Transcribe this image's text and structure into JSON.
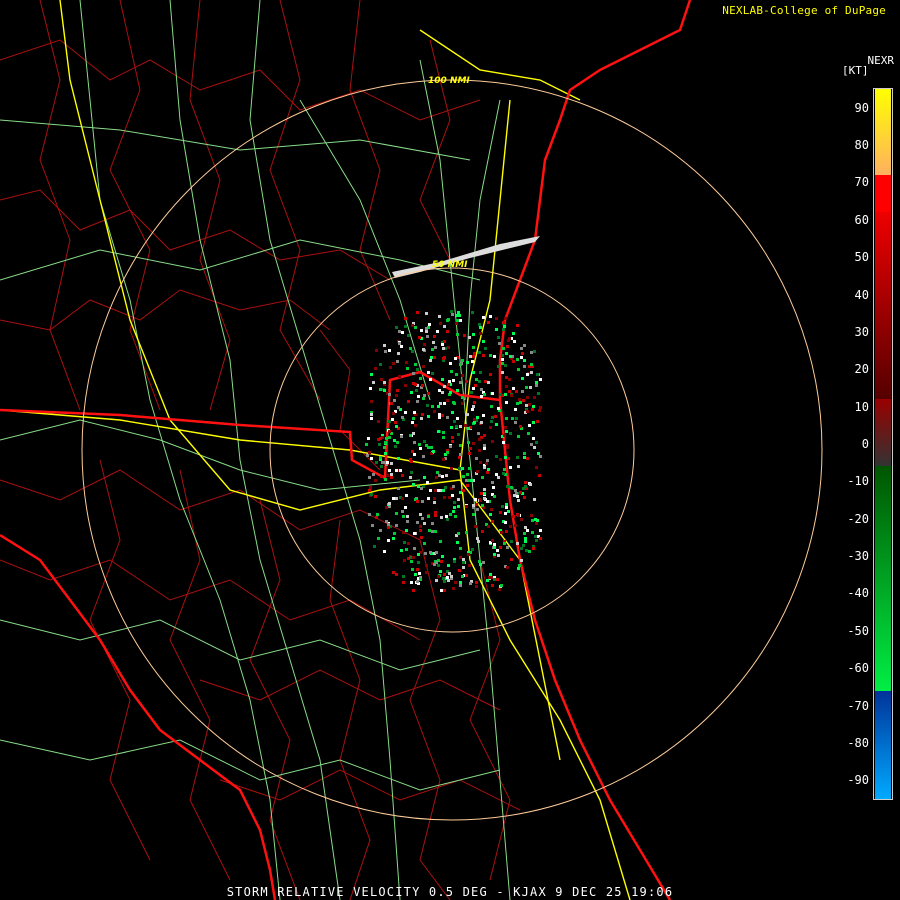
{
  "credit": "NEXLAB-College of DuPage",
  "product_code": "NEXR",
  "units": "[KT]",
  "colorbar": {
    "ticks": [
      "90",
      "80",
      "70",
      "60",
      "50",
      "40",
      "30",
      "20",
      "10",
      "0",
      "-10",
      "-20",
      "-30",
      "-40",
      "-50",
      "-60",
      "-70",
      "-80",
      "-90"
    ],
    "range": [
      -95,
      95
    ],
    "bands": [
      {
        "from": 95,
        "to": 72,
        "top_color": "#ffff00",
        "bottom_color": "#ffb060"
      },
      {
        "from": 72,
        "to": 62,
        "top_color": "#ff0000",
        "bottom_color": "#ff0000"
      },
      {
        "from": 62,
        "to": 12,
        "top_color": "#ee0000",
        "bottom_color": "#550000"
      },
      {
        "from": 12,
        "to": -6,
        "top_color": "#990000",
        "bottom_color": "#333333"
      },
      {
        "from": -6,
        "to": -66,
        "top_color": "#005500",
        "bottom_color": "#00ee44"
      },
      {
        "from": -66,
        "to": -95,
        "top_color": "#003399",
        "bottom_color": "#00aaff"
      }
    ]
  },
  "range_rings": [
    {
      "label": "100 NMI",
      "radius_nmi": 100
    },
    {
      "label": "50 NMI",
      "radius_nmi": 50
    }
  ],
  "footer": "STORM RELATIVE VELOCITY 0.5 DEG - KJAX 9 DEC 25 19:06",
  "colors": {
    "background": "#000000",
    "county_lines": "#aa1111",
    "state_lines": "#ff1111",
    "coastline": "#ff1111",
    "highways": "#ffff00",
    "roads": "#88dd88",
    "range_rings": "#ffcc99"
  }
}
